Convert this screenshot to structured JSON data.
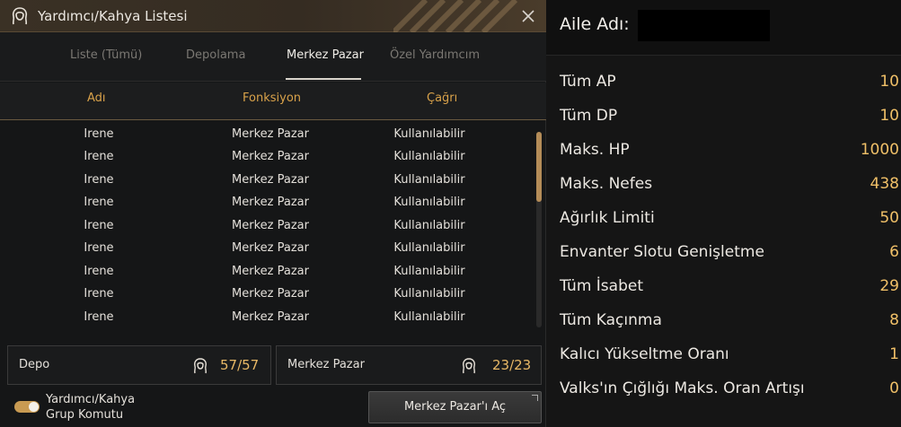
{
  "window": {
    "title": "Yardımcı/Kahya Listesi"
  },
  "tabs": [
    {
      "label": "Liste (Tümü)"
    },
    {
      "label": "Depolama"
    },
    {
      "label": "Merkez Pazar",
      "active": true
    },
    {
      "label": "Özel Yardımcım"
    }
  ],
  "columns": [
    "Adı",
    "Fonksiyon",
    "Çağrı"
  ],
  "rows": [
    {
      "name": "Irene",
      "function": "Merkez Pazar",
      "call": "Kullanılabilir"
    },
    {
      "name": "Irene",
      "function": "Merkez Pazar",
      "call": "Kullanılabilir"
    },
    {
      "name": "Irene",
      "function": "Merkez Pazar",
      "call": "Kullanılabilir"
    },
    {
      "name": "Irene",
      "function": "Merkez Pazar",
      "call": "Kullanılabilir"
    },
    {
      "name": "Irene",
      "function": "Merkez Pazar",
      "call": "Kullanılabilir"
    },
    {
      "name": "Irene",
      "function": "Merkez Pazar",
      "call": "Kullanılabilir"
    },
    {
      "name": "Irene",
      "function": "Merkez Pazar",
      "call": "Kullanılabilir"
    },
    {
      "name": "Irene",
      "function": "Merkez Pazar",
      "call": "Kullanılabilir"
    },
    {
      "name": "Irene",
      "function": "Merkez Pazar",
      "call": "Kullanılabilir"
    }
  ],
  "storage": {
    "depo_label": "Depo",
    "depo_count": "57/57",
    "market_label": "Merkez Pazar",
    "market_count": "23/23",
    "icon": "helper-head-icon"
  },
  "group_command": {
    "label_line1": "Yardımcı/Kahya",
    "label_line2": "Grup Komutu",
    "enabled": true
  },
  "open_market_button": "Merkez Pazar'ı Aç",
  "family": {
    "label": "Aile Adı:"
  },
  "stats": [
    {
      "label": "Tüm AP",
      "value": "10"
    },
    {
      "label": "Tüm DP",
      "value": "10"
    },
    {
      "label": "Maks. HP",
      "value": "1000"
    },
    {
      "label": "Maks. Nefes",
      "value": "438"
    },
    {
      "label": "Ağırlık Limiti",
      "value": "50"
    },
    {
      "label": "Envanter Slotu Genişletme",
      "value": "6"
    },
    {
      "label": "Tüm İsabet",
      "value": "29"
    },
    {
      "label": "Tüm Kaçınma",
      "value": "8"
    },
    {
      "label": "Kalıcı Yükseltme Oranı",
      "value": "1"
    },
    {
      "label": "Valks'ın Çığlığı Maks. Oran Artışı",
      "value": "0"
    }
  ],
  "colors": {
    "accent": "#d9a24a",
    "value": "#f0c068",
    "toggle": "#c89a52"
  }
}
